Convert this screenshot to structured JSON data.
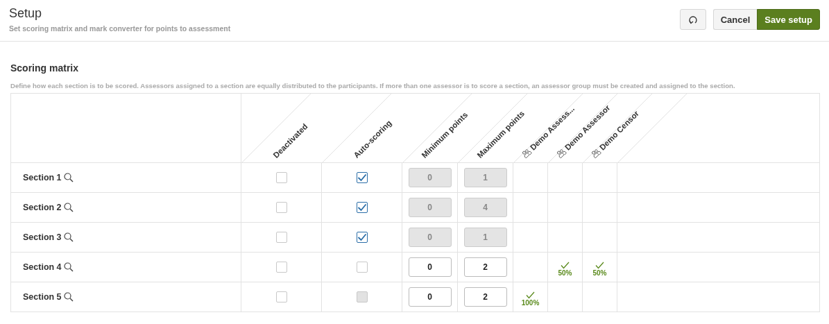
{
  "header": {
    "title": "Setup",
    "subtitle": "Set scoring matrix and mark converter for points to assessment",
    "buttons": [
      {
        "kind": "reset"
      },
      {
        "kind": "cancel",
        "label": "Cancel"
      },
      {
        "kind": "primary",
        "label": "Save setup"
      }
    ]
  },
  "scoring_matrix": {
    "title": "Scoring matrix",
    "description": "Define how each section is to be scored. Assessors assigned to a section are equally distributed to the participants. If more than one assessor is to score a section, an assessor group must be created and assigned to the section.",
    "columns": [
      {
        "kind": "option",
        "label": "Deactivated"
      },
      {
        "kind": "option",
        "label": "Auto-scoring"
      },
      {
        "kind": "points",
        "label": "Minimum points"
      },
      {
        "kind": "points",
        "label": "Maximum points"
      },
      {
        "kind": "assessor",
        "label": "Demo Assess..."
      },
      {
        "kind": "assessor",
        "label": "Demo Assessor"
      },
      {
        "kind": "assessor",
        "label": "Demo Censor"
      }
    ],
    "rows": [
      {
        "name": "Section 1",
        "deactivated": {
          "checked": false,
          "disabled": false
        },
        "auto_scoring": {
          "checked": true,
          "disabled": false
        },
        "min_points": {
          "value": "0",
          "disabled": true
        },
        "max_points": {
          "value": "1",
          "disabled": true
        },
        "assessors": [
          {
            "assigned": false
          },
          {
            "assigned": false
          },
          {
            "assigned": false
          }
        ]
      },
      {
        "name": "Section 2",
        "deactivated": {
          "checked": false,
          "disabled": false
        },
        "auto_scoring": {
          "checked": true,
          "disabled": false
        },
        "min_points": {
          "value": "0",
          "disabled": true
        },
        "max_points": {
          "value": "4",
          "disabled": true
        },
        "assessors": [
          {
            "assigned": false
          },
          {
            "assigned": false
          },
          {
            "assigned": false
          }
        ]
      },
      {
        "name": "Section 3",
        "deactivated": {
          "checked": false,
          "disabled": false
        },
        "auto_scoring": {
          "checked": true,
          "disabled": false
        },
        "min_points": {
          "value": "0",
          "disabled": true
        },
        "max_points": {
          "value": "1",
          "disabled": true
        },
        "assessors": [
          {
            "assigned": false
          },
          {
            "assigned": false
          },
          {
            "assigned": false
          }
        ]
      },
      {
        "name": "Section 4",
        "deactivated": {
          "checked": false,
          "disabled": false
        },
        "auto_scoring": {
          "checked": false,
          "disabled": false
        },
        "min_points": {
          "value": "0",
          "disabled": false
        },
        "max_points": {
          "value": "2",
          "disabled": false
        },
        "assessors": [
          {
            "assigned": false
          },
          {
            "assigned": true,
            "share": "50%"
          },
          {
            "assigned": true,
            "share": "50%"
          }
        ]
      },
      {
        "name": "Section 5",
        "deactivated": {
          "checked": false,
          "disabled": false
        },
        "auto_scoring": {
          "checked": false,
          "disabled": true
        },
        "min_points": {
          "value": "0",
          "disabled": false
        },
        "max_points": {
          "value": "2",
          "disabled": false
        },
        "assessors": [
          {
            "assigned": true,
            "share": "100%"
          },
          {
            "assigned": false
          },
          {
            "assigned": false
          }
        ]
      }
    ]
  }
}
